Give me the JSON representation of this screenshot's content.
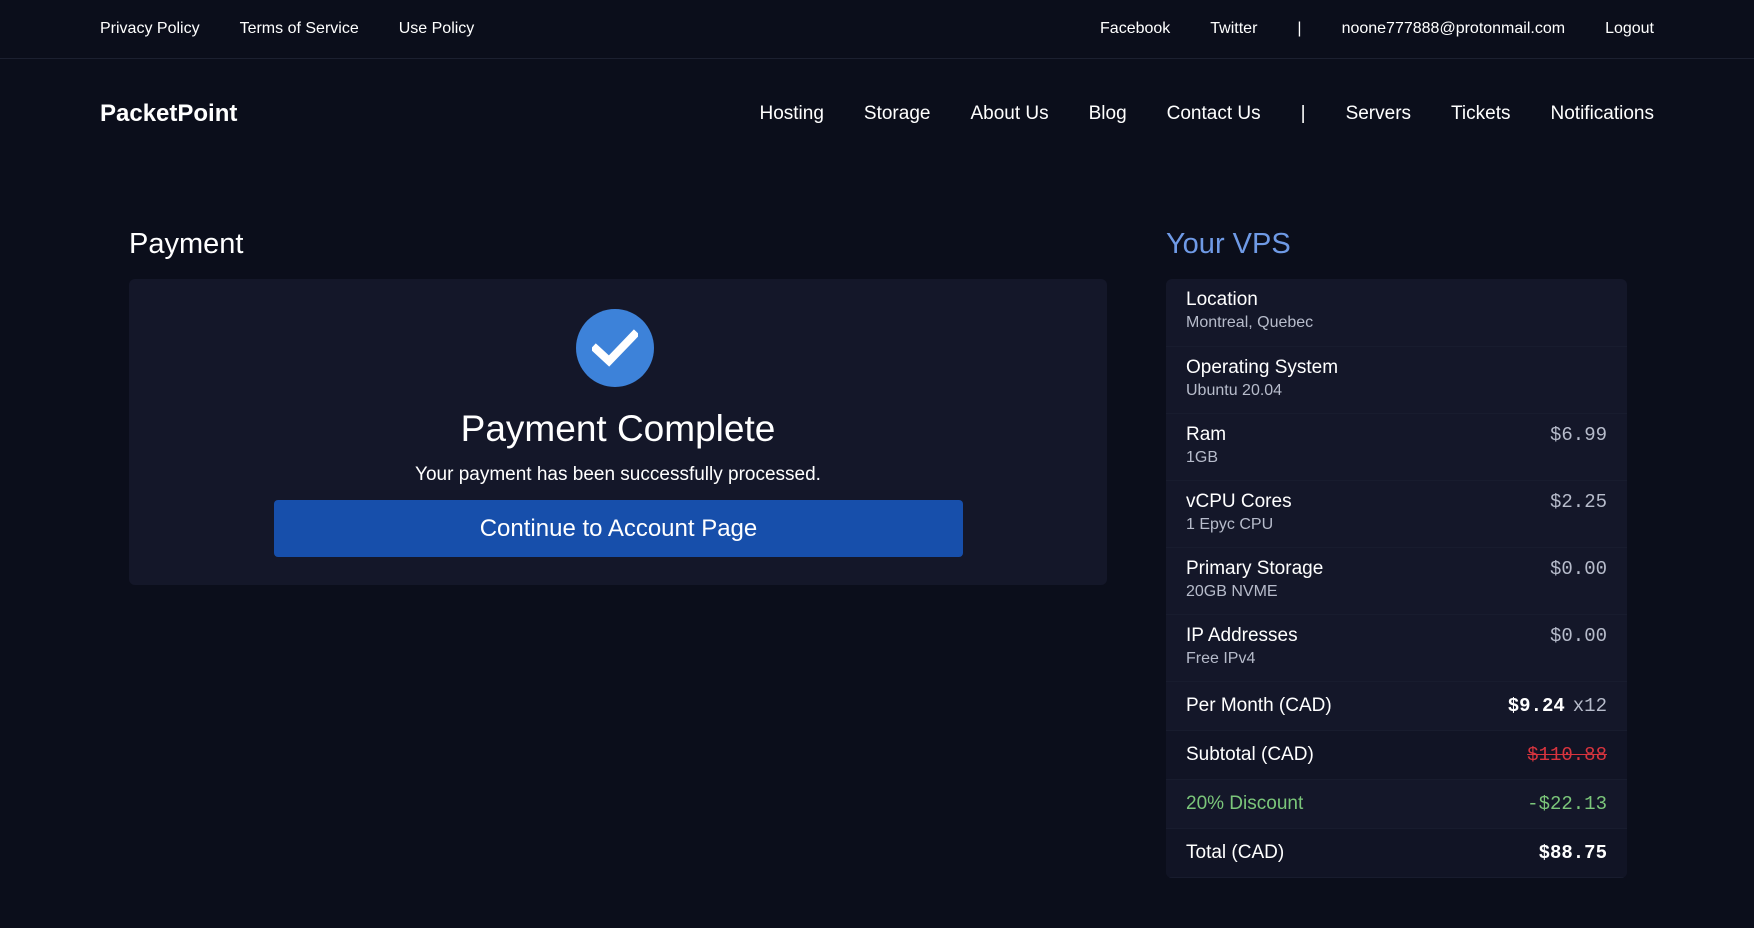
{
  "topbar": {
    "links": [
      "Privacy Policy",
      "Terms of Service",
      "Use Policy"
    ],
    "facebook": "Facebook",
    "twitter": "Twitter",
    "separator": "|",
    "email": "noone777888@protonmail.com",
    "logout": "Logout"
  },
  "navbar": {
    "brand": "PacketPoint",
    "items": [
      "Hosting",
      "Storage",
      "About Us",
      "Blog",
      "Contact Us"
    ],
    "separator": "|",
    "account_items": [
      "Servers",
      "Tickets",
      "Notifications"
    ]
  },
  "payment": {
    "section_title": "Payment",
    "icon": "check-circle-icon",
    "title": "Payment Complete",
    "message": "Your payment has been successfully processed.",
    "button": "Continue to Account Page"
  },
  "vps": {
    "title": "Your VPS",
    "location": {
      "label": "Location",
      "value": "Montreal, Quebec"
    },
    "os": {
      "label": "Operating System",
      "value": "Ubuntu 20.04"
    },
    "items": [
      {
        "label": "Ram",
        "value": "1GB",
        "price": "$6.99"
      },
      {
        "label": "vCPU Cores",
        "value": "1 Epyc CPU",
        "price": "$2.25"
      },
      {
        "label": "Primary Storage",
        "value": "20GB NVME",
        "price": "$0.00"
      },
      {
        "label": "IP Addresses",
        "value": "Free IPv4",
        "price": "$0.00"
      }
    ],
    "per_month": {
      "label": "Per Month (CAD)",
      "price": "$9.24",
      "multiplier": "x12"
    },
    "subtotal": {
      "label": "Subtotal (CAD)",
      "price": "$110.88"
    },
    "discount": {
      "label": "20% Discount",
      "price": "-$22.13"
    },
    "total": {
      "label": "Total (CAD)",
      "price": "$88.75"
    }
  },
  "colors": {
    "background": "#0b0e1b",
    "card": "#141729",
    "accent": "#3d82d9",
    "button": "#174fab",
    "vps_title": "#6f9ae6",
    "discount": "#7bc67a",
    "strike": "#d8343e"
  }
}
